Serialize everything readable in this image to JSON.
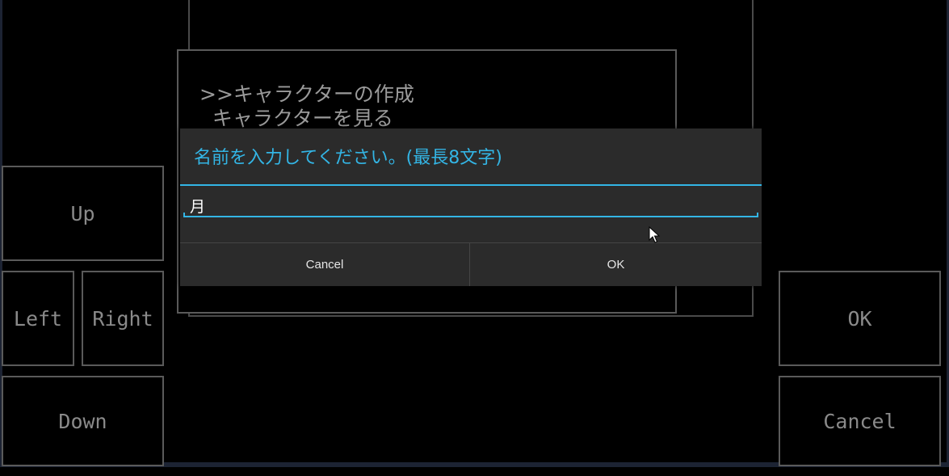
{
  "menu": {
    "items": [
      {
        "label": ">>キャラクターの作成"
      },
      {
        "label": "  キャラクターを見る"
      }
    ]
  },
  "dpad": {
    "up_label": "Up",
    "left_label": "Left",
    "right_label": "Right",
    "down_label": "Down"
  },
  "actions": {
    "ok_label": "OK",
    "cancel_label": "Cancel"
  },
  "dialog": {
    "title": "名前を入力してください。(最長8文字)",
    "input_value": "月",
    "cancel_label": "Cancel",
    "ok_label": "OK"
  },
  "colors": {
    "accent": "#33b5e5",
    "dialog_bg": "#2b2b2b",
    "game_text": "#8a8a8a",
    "frame": "#1c2333"
  },
  "icons": {
    "cursor": "mouse-pointer-icon"
  }
}
